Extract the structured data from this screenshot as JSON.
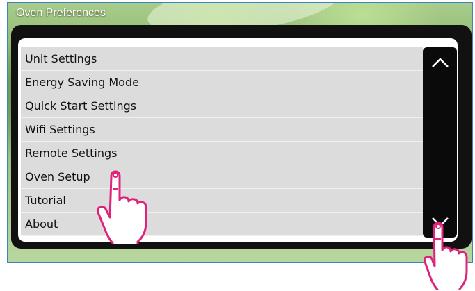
{
  "window": {
    "title": "Oven Preferences"
  },
  "menu": {
    "items": [
      {
        "label": "Unit Settings"
      },
      {
        "label": "Energy Saving Mode"
      },
      {
        "label": "Quick Start Settings"
      },
      {
        "label": "Wifi Settings"
      },
      {
        "label": "Remote Settings"
      },
      {
        "label": "Oven Setup"
      },
      {
        "label": "Tutorial"
      },
      {
        "label": "About"
      }
    ]
  },
  "scrollbar": {
    "up_icon": "chevron-up-icon",
    "down_icon": "chevron-down-icon"
  },
  "annotations": {
    "pointer_icon": "tap-hand-icon",
    "pointer_color": "#e0237a"
  },
  "colors": {
    "frame_border": "#3b82c4",
    "panel_bg": "#111111",
    "list_item_bg": "#dcdcdc",
    "scrollbar_bg": "#0a0a0a"
  }
}
